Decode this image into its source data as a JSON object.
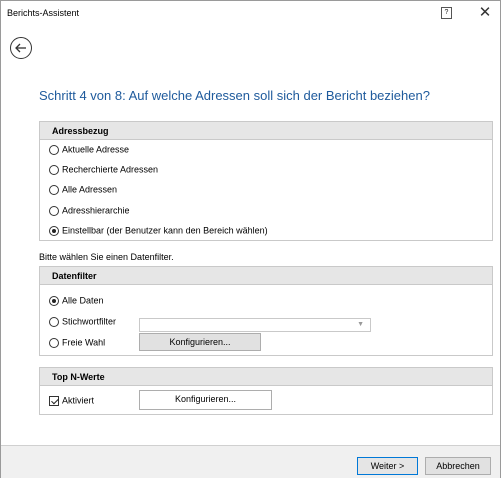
{
  "window": {
    "title": "Berichts-Assistent",
    "help_label": "?",
    "close_label": "✕"
  },
  "step_title": "Schritt 4 von 8: Auf welche Adressen soll sich der Bericht beziehen?",
  "adressbezug": {
    "header": "Adressbezug",
    "options": [
      {
        "label": "Aktuelle Adresse",
        "selected": false
      },
      {
        "label": "Recherchierte Adressen",
        "selected": false
      },
      {
        "label": "Alle Adressen",
        "selected": false
      },
      {
        "label": "Adresshierarchie",
        "selected": false
      },
      {
        "label": "Einstellbar (der Benutzer kann den Bereich wählen)",
        "selected": true
      }
    ]
  },
  "hint": "Bitte wählen Sie einen Datenfilter.",
  "datenfilter": {
    "header": "Datenfilter",
    "options": [
      {
        "label": "Alle Daten",
        "selected": true
      },
      {
        "label": "Stichwortfilter",
        "selected": false
      },
      {
        "label": "Freie Wahl",
        "selected": false
      }
    ],
    "combo_value": "",
    "configure_label": "Konfigurieren..."
  },
  "topn": {
    "header": "Top N-Werte",
    "checkbox_label": "Aktiviert",
    "checked": true,
    "configure_label": "Konfigurieren..."
  },
  "footer": {
    "next_label": "Weiter >",
    "cancel_label": "Abbrechen"
  },
  "colors": {
    "step_title": "#1e5a9c",
    "group_header_bg": "#e6e6e6",
    "footer_bg": "#f0f0f0",
    "default_button_border": "#0078d7"
  },
  "icons": {
    "back": "back-arrow-circle-icon",
    "help": "help-icon",
    "close": "close-icon",
    "combo_arrow": "chevron-down-icon"
  }
}
